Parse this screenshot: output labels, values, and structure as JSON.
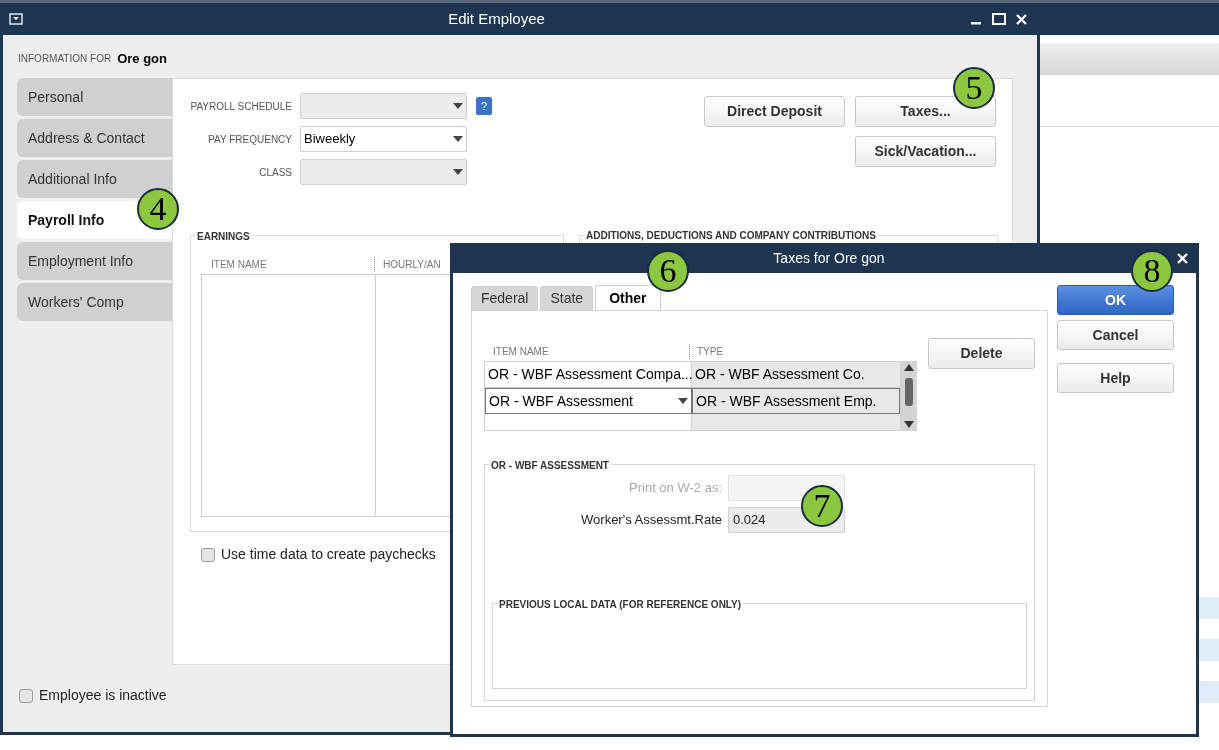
{
  "edit_window": {
    "title": "Edit Employee",
    "information_for_label": "INFORMATION FOR",
    "employee_name": "Ore gon",
    "sidebar_tabs": [
      {
        "label": "Personal",
        "selected": false
      },
      {
        "label": "Address & Contact",
        "selected": false
      },
      {
        "label": "Additional Info",
        "selected": false
      },
      {
        "label": "Payroll Info",
        "selected": true
      },
      {
        "label": "Employment Info",
        "selected": false
      },
      {
        "label": "Workers' Comp",
        "selected": false
      }
    ],
    "payroll_fields": [
      {
        "label": "PAYROLL SCHEDULE",
        "help": "?"
      },
      {
        "label": "PAY FREQUENCY",
        "value": "Biweekly"
      },
      {
        "label": "CLASS"
      }
    ],
    "buttons": [
      {
        "label": "Direct Deposit"
      },
      {
        "label": "Taxes..."
      },
      {
        "label": "Sick/Vacation..."
      }
    ],
    "earnings": {
      "title": "EARNINGS",
      "columns": [
        "ITEM NAME",
        "HOURLY/AN"
      ]
    },
    "additions": {
      "title": "ADDITIONS, DEDUCTIONS AND COMPANY CONTRIBUTIONS"
    },
    "use_time_data": {
      "label": "Use time data to create paychecks",
      "checked": false
    },
    "inactive": {
      "label": "Employee is inactive",
      "checked": false
    }
  },
  "taxes_dialog": {
    "title": "Taxes for Ore gon",
    "tabs": [
      {
        "label": "Federal",
        "selected": false
      },
      {
        "label": "State",
        "selected": false
      },
      {
        "label": "Other",
        "selected": true
      }
    ],
    "table": {
      "columns": [
        "ITEM NAME",
        "TYPE"
      ],
      "rows": [
        {
          "item_name": "OR - WBF Assessment Compa...",
          "type": "OR - WBF Assessment Co.",
          "selected": false
        },
        {
          "item_name": "OR - WBF Assessment",
          "type": "OR - WBF Assessment Emp.",
          "selected": true
        }
      ]
    },
    "delete_button": "Delete",
    "buttons": [
      {
        "label": "OK",
        "primary": true
      },
      {
        "label": "Cancel",
        "primary": false
      },
      {
        "label": "Help",
        "primary": false
      }
    ],
    "assessment": {
      "title": "OR - WBF ASSESSMENT",
      "fields": [
        {
          "label": "Print on W-2 as:",
          "disabled": true
        },
        {
          "label": "Worker's Assessmt.Rate",
          "value": "0.024",
          "disabled": false
        }
      ]
    },
    "previous_local": {
      "title": "PREVIOUS LOCAL DATA (FOR REFERENCE ONLY)"
    }
  },
  "callouts": [
    "4",
    "5",
    "6",
    "7",
    "8"
  ]
}
